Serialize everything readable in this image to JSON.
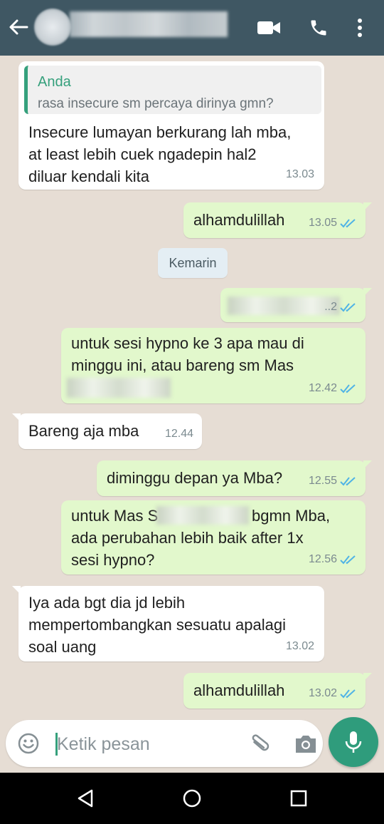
{
  "header": {
    "back_icon": "arrow-left-icon",
    "contact_name": "",
    "actions": [
      "video-call-icon",
      "phone-icon",
      "more-vert-icon"
    ]
  },
  "colors": {
    "header_bg": "#3f5763",
    "chat_bg": "#e6ddd4",
    "incoming_bubble": "#ffffff",
    "outgoing_bubble": "#e2f8cc",
    "accent": "#35a07c",
    "read_ticks": "#4fb3e6"
  },
  "messages": [
    {
      "direction": "in",
      "quote_author": "Anda",
      "quote_text": "rasa insecure sm percaya dirinya gmn?",
      "lines": [
        "Insecure lumayan berkurang lah mba,",
        "at least lebih cuek ngadepin hal2",
        "diluar kendali kita"
      ],
      "time": "13.03"
    },
    {
      "direction": "out",
      "lines": [
        "alhamdulillah"
      ],
      "time": "13.05",
      "status": "read"
    },
    {
      "direction": "out",
      "lines": [
        ""
      ],
      "time": "..2",
      "status": "read",
      "redacted": true
    },
    {
      "direction": "out",
      "lines": [
        "untuk sesi hypno ke 3 apa mau di",
        "minggu ini, atau bareng sm Mas",
        ""
      ],
      "time": "12.42",
      "status": "read",
      "redacted": true
    },
    {
      "direction": "in",
      "lines": [
        "Bareng aja mba"
      ],
      "time": "12.44"
    },
    {
      "direction": "out",
      "lines": [
        "diminggu depan ya Mba?"
      ],
      "time": "12.55",
      "status": "read"
    },
    {
      "direction": "out",
      "lines": [
        "untuk Mas S",
        "bgmn Mba,",
        "ada perubahan lebih baik after 1x",
        "sesi hypno?"
      ],
      "time": "12.56",
      "status": "read",
      "redacted": true
    },
    {
      "direction": "in",
      "lines": [
        "Iya ada bgt dia jd lebih",
        "mempertombangkan sesuatu apalagi",
        "soal uang"
      ],
      "time": "13.02"
    },
    {
      "direction": "out",
      "lines": [
        "alhamdulillah"
      ],
      "time": "13.02",
      "status": "read"
    }
  ],
  "date_separator": "Kemarin",
  "composer": {
    "placeholder": "Ketik pesan",
    "emoji_icon": "emoji-icon",
    "attach_icon": "paperclip-icon",
    "camera_icon": "camera-icon",
    "mic_icon": "microphone-icon"
  },
  "navigation": [
    "back-triangle-icon",
    "home-circle-icon",
    "recents-square-icon"
  ]
}
